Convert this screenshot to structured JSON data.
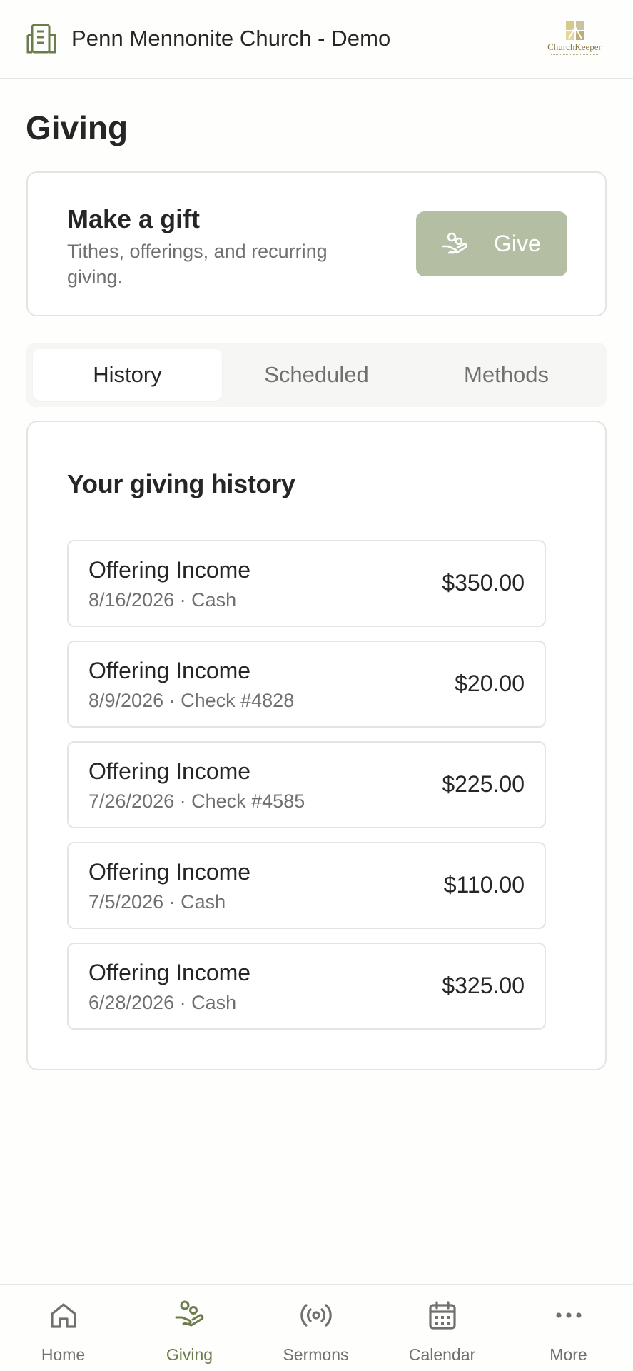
{
  "header": {
    "title": "Penn Mennonite Church - Demo",
    "brand_name": "ChurchKeeper"
  },
  "page": {
    "title": "Giving"
  },
  "gift": {
    "title": "Make a gift",
    "subtitle": "Tithes, offerings, and recurring giving.",
    "button_label": "Give"
  },
  "tabs": [
    {
      "label": "History",
      "active": true
    },
    {
      "label": "Scheduled",
      "active": false
    },
    {
      "label": "Methods",
      "active": false
    }
  ],
  "history": {
    "title": "Your giving history",
    "items": [
      {
        "name": "Offering Income",
        "meta": "8/16/2026 · Cash",
        "amount": "$350.00"
      },
      {
        "name": "Offering Income",
        "meta": "8/9/2026 · Check #4828",
        "amount": "$20.00"
      },
      {
        "name": "Offering Income",
        "meta": "7/26/2026 · Check #4585",
        "amount": "$225.00"
      },
      {
        "name": "Offering Income",
        "meta": "7/5/2026 · Cash",
        "amount": "$110.00"
      },
      {
        "name": "Offering Income",
        "meta": "6/28/2026 · Cash",
        "amount": "$325.00"
      }
    ]
  },
  "nav": [
    {
      "label": "Home",
      "icon": "home-icon",
      "active": false
    },
    {
      "label": "Giving",
      "icon": "giving-icon",
      "active": true
    },
    {
      "label": "Sermons",
      "icon": "broadcast-icon",
      "active": false
    },
    {
      "label": "Calendar",
      "icon": "calendar-icon",
      "active": false
    },
    {
      "label": "More",
      "icon": "more-icon",
      "active": false
    }
  ],
  "colors": {
    "accent": "#6b7d4a",
    "give_button": "#b4bea3",
    "muted_text": "#707070"
  }
}
